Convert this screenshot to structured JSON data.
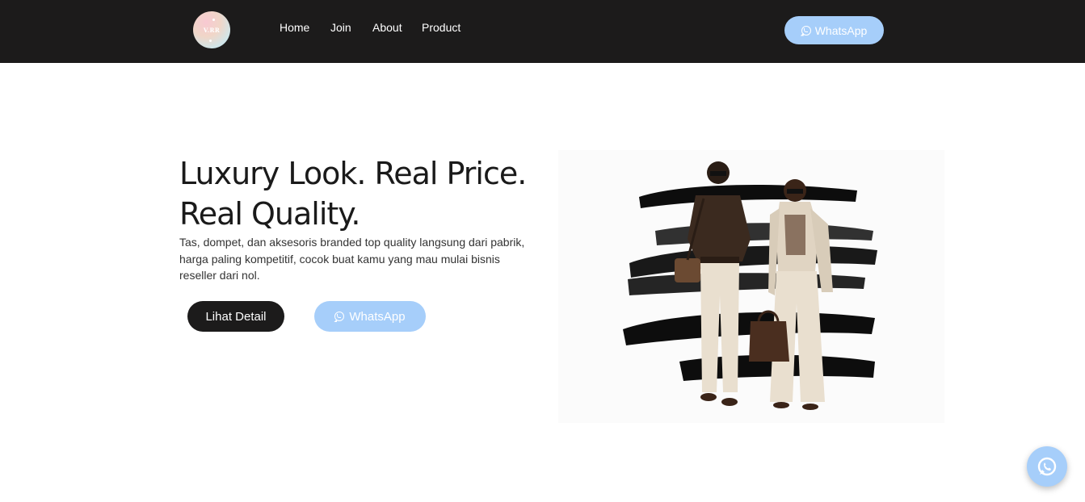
{
  "header": {
    "logo_text": "V.RR",
    "nav": {
      "home": "Home",
      "join": "Join",
      "about": "About",
      "product": "Product"
    },
    "whatsapp_label": "WhatsApp",
    "whatsapp_icon": "whatsapp-icon"
  },
  "hero": {
    "title_line1": "Luxury Look. Real Price.",
    "title_line2": "Real Quality.",
    "description": "Tas, dompet, dan aksesoris branded top quality  langsung dari pabrik, harga paling kompetitif, cocok buat kamu yang mau mulai bisnis reseller dari nol.",
    "detail_button": "Lihat Detail",
    "whatsapp_button": "WhatsApp",
    "image_icon": "fashion-couple-image"
  },
  "floating": {
    "icon": "whatsapp-icon"
  },
  "colors": {
    "navbar_bg": "#1c1b1b",
    "accent": "#a6cefa",
    "text": "#1a1a1a"
  }
}
